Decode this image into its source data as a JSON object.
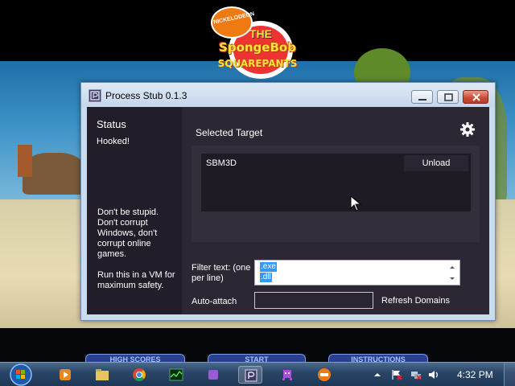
{
  "game": {
    "logo_badge": "NICKELODEON",
    "logo_the": "THE",
    "logo_title": "SpongeBob",
    "logo_subtitle": "SQUAREPANTS",
    "menu_items": [
      "HIGH SCORES",
      "START",
      "INSTRUCTIONS"
    ]
  },
  "window": {
    "title": "Process Stub 0.1.3",
    "icon": "process-stub-app-icon",
    "controls": [
      "minimize",
      "maximize",
      "close"
    ]
  },
  "sidebar": {
    "status_heading": "Status",
    "status_value": "Hooked!",
    "warning_text": "Don't be stupid. Don't corrupt Windows, don't corrupt online games.",
    "vm_note": "Run this in a VM for maximum safety."
  },
  "main": {
    "target_heading": "Selected Target",
    "settings_icon": "gear-icon",
    "targets": [
      {
        "name": "SBM3D",
        "action_label": "Unload"
      }
    ],
    "filter": {
      "label": "Filter text: (one per line)",
      "lines": [
        ".exe",
        ".dll"
      ]
    },
    "autoattach": {
      "label": "Auto-attach",
      "value": ""
    },
    "refresh_label": "Refresh Domains"
  },
  "taskbar": {
    "pinned": [
      "windows-media-player-icon",
      "file-explorer-icon",
      "chrome-icon",
      "task-manager-icon",
      "purple-app-icon",
      "process-stub-icon",
      "pixel-game-icon",
      "nick-icon"
    ],
    "clock": "4:32 PM"
  },
  "colors": {
    "client_bg": "#2a2530",
    "sidebar_bg": "#221d28",
    "selection": "#3399ff",
    "titlebar": "#c4d6ea"
  }
}
